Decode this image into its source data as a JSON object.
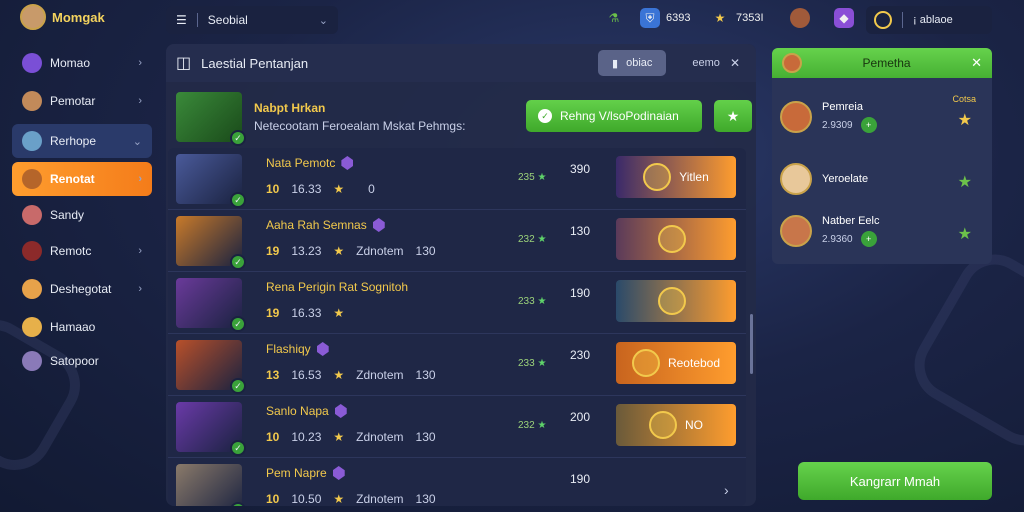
{
  "brand": {
    "name": "Momgak"
  },
  "sidebar": {
    "items": [
      {
        "label": "Momao",
        "icon": "shield-icon",
        "color": "#7a4fd6",
        "chevron": true
      },
      {
        "label": "Pemotar",
        "icon": "hero-avatar-icon",
        "color": "#c28a5a",
        "chevron": true
      },
      {
        "label": "Rerhope",
        "icon": "hero-avatar-icon",
        "color": "#6aa0c8",
        "chevron": true
      },
      {
        "label": "Renotat",
        "icon": "sword-icon",
        "color": "#b5652a",
        "chevron": true
      },
      {
        "label": "Sandy",
        "icon": "hero-avatar-icon",
        "color": "#c86a6a",
        "chevron": false
      },
      {
        "label": "Remotc",
        "icon": "hero-avatar-icon",
        "color": "#8c2a2a",
        "chevron": true
      },
      {
        "label": "Deshegotat",
        "icon": "hero-avatar-icon",
        "color": "#e7a24a",
        "chevron": true
      },
      {
        "label": "Hamaao",
        "icon": "sword-icon",
        "color": "#e7b04a",
        "chevron": false
      },
      {
        "label": "Satopoor",
        "icon": "gem-icon",
        "color": "#8a7ab8",
        "chevron": false
      }
    ]
  },
  "topbar": {
    "search_label": "Seobial",
    "stats": [
      {
        "icon": "potion-icon",
        "color": "#6cc24a",
        "value": ""
      },
      {
        "icon": "shield-icon",
        "color": "#3a74d6",
        "value": "6393"
      },
      {
        "icon": "star-icon",
        "color": "#f2c94c",
        "value": "7353I"
      },
      {
        "icon": "hero-avatar-icon",
        "color": "#a05a3a",
        "value": ""
      },
      {
        "icon": "gem-icon",
        "color": "#8a4fd6",
        "value": ""
      }
    ],
    "currency_value": "¡ ablaoe"
  },
  "main": {
    "title": "Laestial Pentanjan",
    "tab_active": "obiac",
    "tab_other": "eemo",
    "hero": {
      "name": "Nabpt Hrkan",
      "desc": "Netecootam Feroealam Mskat Pehmgs:",
      "button": "Rehng V/lsoPodinaian"
    },
    "rows": [
      {
        "name": "Nata Pemotc",
        "gem": "purple-gem-icon",
        "level": "10",
        "value": "16.33",
        "extra": "",
        "extra2": "0",
        "pts": "235",
        "score": "390",
        "card": "Yitlen",
        "card_color": "#3a2a6a",
        "portrait": "#4a5a9a"
      },
      {
        "name": "Aaha Rah Semnas",
        "gem": "blue-shield-icon",
        "level": "19",
        "value": "13.23",
        "extra": "Zdnotem",
        "extra2": "130",
        "pts": "232",
        "score": "130",
        "card": "",
        "card_color": "#5a3a5a",
        "portrait": "#c87a2a"
      },
      {
        "name": "Rena Perigin Rat Sognitoh",
        "gem": "",
        "level": "19",
        "value": "16.33",
        "extra": "",
        "extra2": "",
        "pts": "233",
        "score": "190",
        "card": "",
        "card_color": "#2a4a6a",
        "portrait": "#6a3a9a"
      },
      {
        "name": "Flashiqy",
        "gem": "orange-gem-icon",
        "level": "13",
        "value": "16.53",
        "extra": "Zdnotem",
        "extra2": "130",
        "pts": "233",
        "score": "230",
        "card": "Reotebod",
        "card_color": "#c8641e",
        "portrait": "#b8502a"
      },
      {
        "name": "Sanlo Napa",
        "gem": "purple-gem-icon",
        "level": "10",
        "value": "10.23",
        "extra": "Zdnotem",
        "extra2": "130",
        "pts": "232",
        "score": "200",
        "card": "NO",
        "card_color": "#6a5a3a",
        "portrait": "#6a3aa8"
      },
      {
        "name": "Pem Napre",
        "gem": "purple-gem-icon",
        "level": "10",
        "value": "10.50",
        "extra": "Zdnotem",
        "extra2": "130",
        "pts": "",
        "score": "190",
        "card": "",
        "card_color": "",
        "portrait": "#8a7a6a"
      }
    ]
  },
  "right_panel": {
    "title": "Pemetha",
    "friends": [
      {
        "name": "Pemreia",
        "sub": "2.9309",
        "tag": "Cotsa",
        "star_color": "#f2c94c",
        "av": "#c86a3a"
      },
      {
        "name": "Yeroelate",
        "sub": "",
        "tag": "",
        "star_color": "#6cc24a",
        "av": "#e8c89a"
      },
      {
        "name": "Natber Eelc",
        "sub": "2.9360",
        "tag": "",
        "star_color": "#6cc24a",
        "av": "#c8764a"
      }
    ]
  },
  "footer_button": "Kangrarr Mmah"
}
